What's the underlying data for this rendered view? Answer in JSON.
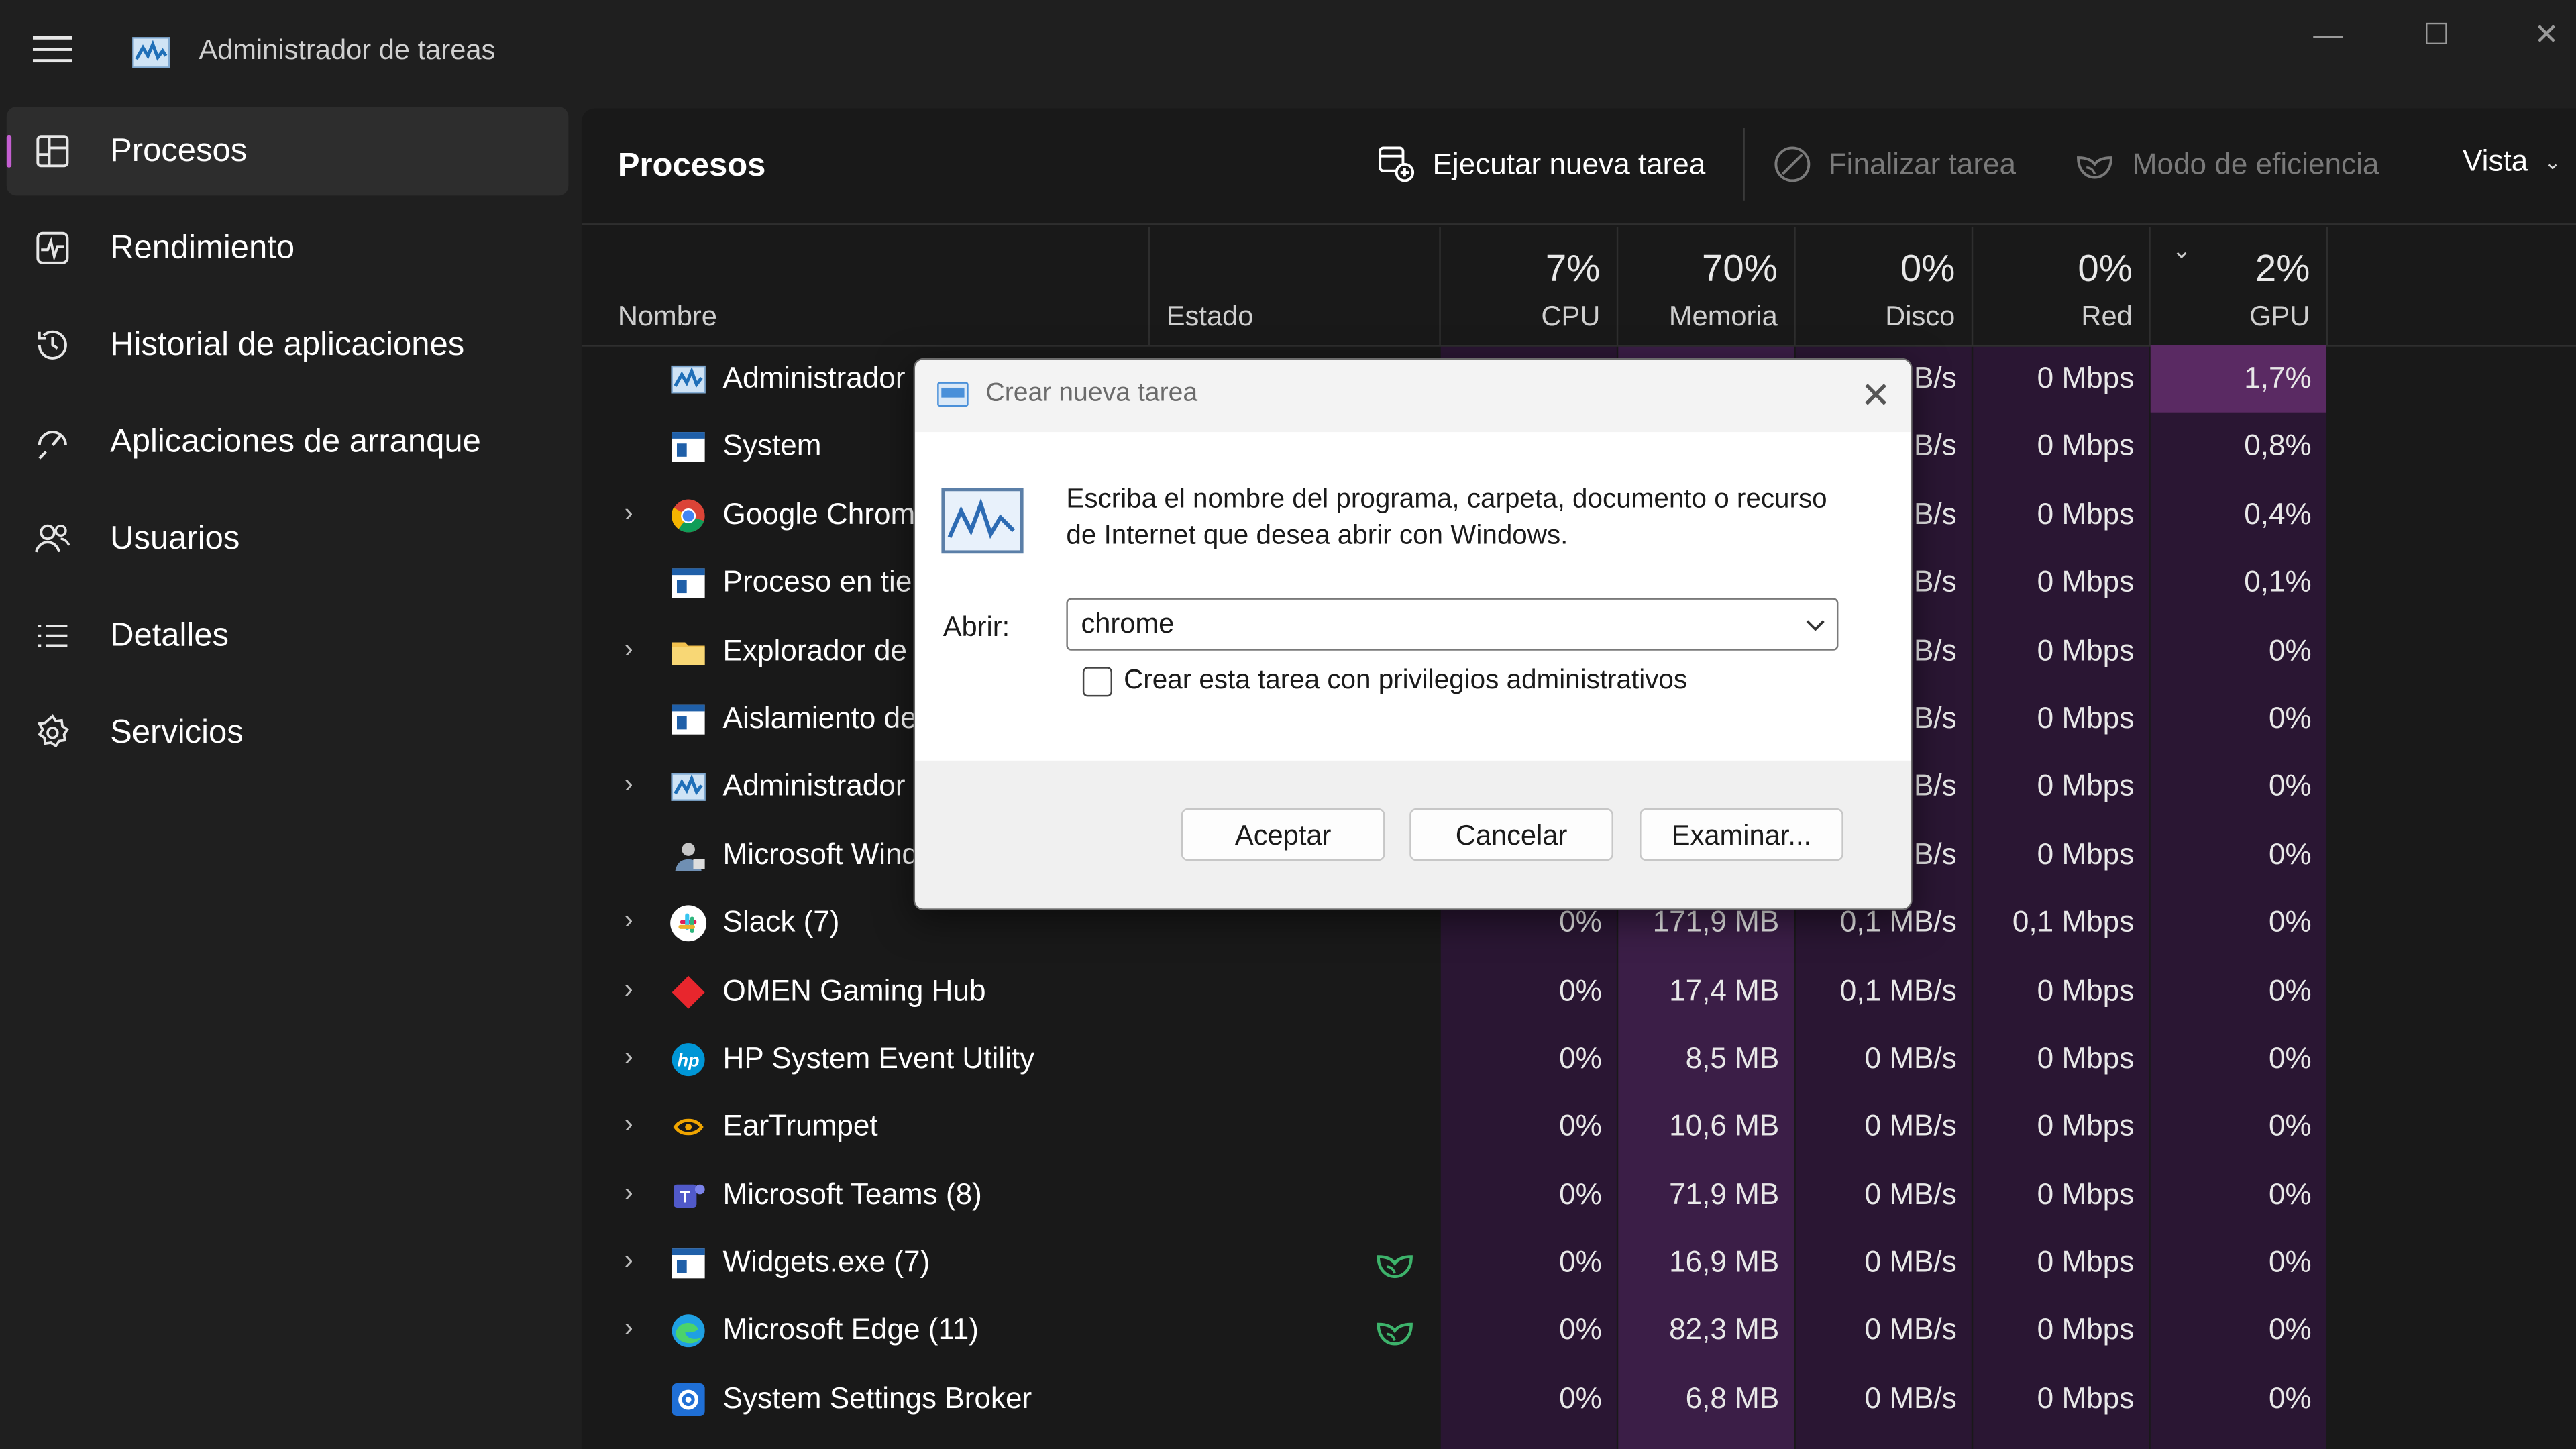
{
  "window": {
    "title": "Administrador de tareas",
    "controls": [
      "minimize",
      "maximize",
      "close"
    ]
  },
  "sidebar": {
    "items": [
      {
        "label": "Procesos",
        "icon": "processes-icon",
        "active": true
      },
      {
        "label": "Rendimiento",
        "icon": "performance-icon"
      },
      {
        "label": "Historial de aplicaciones",
        "icon": "history-icon"
      },
      {
        "label": "Aplicaciones de arranque",
        "icon": "startup-icon"
      },
      {
        "label": "Usuarios",
        "icon": "users-icon"
      },
      {
        "label": "Detalles",
        "icon": "details-icon"
      },
      {
        "label": "Servicios",
        "icon": "services-icon"
      }
    ]
  },
  "toolbar": {
    "title": "Procesos",
    "run_task": "Ejecutar nueva tarea",
    "end_task": "Finalizar tarea",
    "efficiency": "Modo de eficiencia",
    "view": "Vista"
  },
  "table": {
    "headers": {
      "name": "Nombre",
      "status": "Estado",
      "cpu_pct": "7%",
      "cpu": "CPU",
      "mem_pct": "70%",
      "mem": "Memoria",
      "disk_pct": "0%",
      "disk": "Disco",
      "net_pct": "0%",
      "net": "Red",
      "gpu_pct": "2%",
      "gpu": "GPU"
    },
    "rows": [
      {
        "name": "Administrador de tareas",
        "expand": false,
        "icon": "taskmgr-icon",
        "eco": false,
        "cpu": "",
        "mem": "",
        "disk": "MB/s",
        "net": "0 Mbps",
        "gpu": "1,7%"
      },
      {
        "name": "System",
        "expand": false,
        "icon": "app-window-icon",
        "eco": false,
        "cpu": "",
        "mem": "",
        "disk": "MB/s",
        "net": "0 Mbps",
        "gpu": "0,8%"
      },
      {
        "name": "Google Chrome",
        "expand": true,
        "icon": "chrome-icon",
        "eco": false,
        "cpu": "",
        "mem": "",
        "disk": "MB/s",
        "net": "0 Mbps",
        "gpu": "0,4%"
      },
      {
        "name": "Proceso en tiempo",
        "expand": false,
        "icon": "app-window-icon",
        "eco": false,
        "cpu": "",
        "mem": "",
        "disk": "MB/s",
        "net": "0 Mbps",
        "gpu": "0,1%"
      },
      {
        "name": "Explorador de Windows",
        "expand": true,
        "icon": "folder-icon",
        "eco": false,
        "cpu": "",
        "mem": "",
        "disk": "MB/s",
        "net": "0 Mbps",
        "gpu": "0%"
      },
      {
        "name": "Aislamiento de",
        "expand": false,
        "icon": "app-window-icon",
        "eco": false,
        "cpu": "",
        "mem": "",
        "disk": "MB/s",
        "net": "0 Mbps",
        "gpu": "0%"
      },
      {
        "name": "Administrador",
        "expand": true,
        "icon": "taskmgr-icon",
        "eco": false,
        "cpu": "",
        "mem": "",
        "disk": "MB/s",
        "net": "0 Mbps",
        "gpu": "0%"
      },
      {
        "name": "Microsoft Windows",
        "expand": false,
        "icon": "user-app-icon",
        "eco": false,
        "cpu": "",
        "mem": "",
        "disk": "MB/s",
        "net": "0 Mbps",
        "gpu": "0%"
      },
      {
        "name": "Slack (7)",
        "expand": true,
        "icon": "slack-icon",
        "eco": false,
        "cpu": "0%",
        "mem": "171,9 MB",
        "disk": "0,1 MB/s",
        "net": "0,1 Mbps",
        "gpu": "0%"
      },
      {
        "name": "OMEN Gaming Hub",
        "expand": true,
        "icon": "omen-icon",
        "eco": false,
        "cpu": "0%",
        "mem": "17,4 MB",
        "disk": "0,1 MB/s",
        "net": "0 Mbps",
        "gpu": "0%"
      },
      {
        "name": "HP System Event Utility",
        "expand": true,
        "icon": "hp-icon",
        "eco": false,
        "cpu": "0%",
        "mem": "8,5 MB",
        "disk": "0 MB/s",
        "net": "0 Mbps",
        "gpu": "0%"
      },
      {
        "name": "EarTrumpet",
        "expand": true,
        "icon": "eartrumpet-icon",
        "eco": false,
        "cpu": "0%",
        "mem": "10,6 MB",
        "disk": "0 MB/s",
        "net": "0 Mbps",
        "gpu": "0%"
      },
      {
        "name": "Microsoft Teams (8)",
        "expand": true,
        "icon": "teams-icon",
        "eco": false,
        "cpu": "0%",
        "mem": "71,9 MB",
        "disk": "0 MB/s",
        "net": "0 Mbps",
        "gpu": "0%"
      },
      {
        "name": "Widgets.exe (7)",
        "expand": true,
        "icon": "app-window-icon",
        "eco": true,
        "cpu": "0%",
        "mem": "16,9 MB",
        "disk": "0 MB/s",
        "net": "0 Mbps",
        "gpu": "0%"
      },
      {
        "name": "Microsoft Edge (11)",
        "expand": true,
        "icon": "edge-icon",
        "eco": true,
        "cpu": "0%",
        "mem": "82,3 MB",
        "disk": "0 MB/s",
        "net": "0 Mbps",
        "gpu": "0%"
      },
      {
        "name": "System Settings Broker",
        "expand": false,
        "icon": "settings-gear-icon",
        "eco": false,
        "cpu": "0%",
        "mem": "6,8 MB",
        "disk": "0 MB/s",
        "net": "0 Mbps",
        "gpu": "0%"
      }
    ]
  },
  "dialog": {
    "title": "Crear nueva tarea",
    "message": "Escriba el nombre del programa, carpeta, documento o recurso de Internet que desea abrir con Windows.",
    "open_label": "Abrir:",
    "open_value": "chrome",
    "admin_checkbox": "Crear esta tarea con privilegios administrativos",
    "admin_checked": false,
    "ok": "Aceptar",
    "cancel": "Cancelar",
    "browse": "Examinar..."
  },
  "colors": {
    "accent": "#c45fd1",
    "gpu_highlight": "#5a2a63",
    "heat_column": "#2f1a38",
    "mem_column": "#3b1e47",
    "eco_leaf": "#3db36b"
  }
}
